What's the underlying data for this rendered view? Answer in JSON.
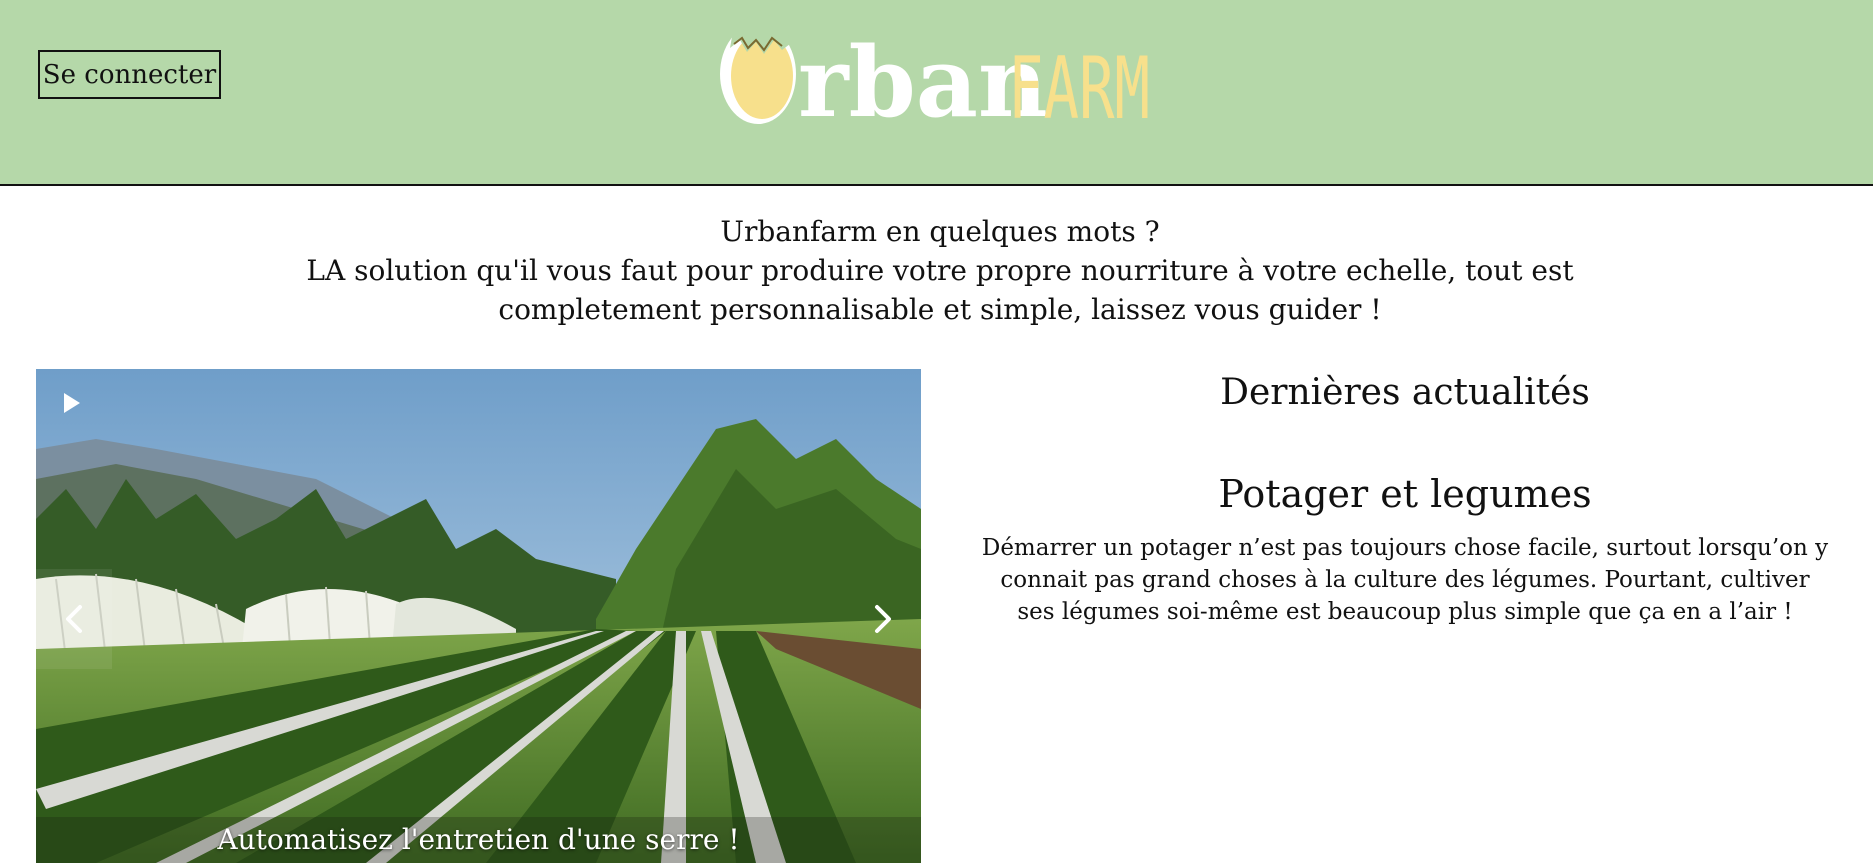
{
  "header": {
    "background_color": "#b5d8a9",
    "login_label": "Se connecter",
    "logo": {
      "text_primary": "rban",
      "text_accent": "FARM",
      "primary_color": "#ffffff",
      "accent_color": "#f7e08c"
    }
  },
  "intro": {
    "title": "Urbanfarm en quelques mots ?",
    "body": "LA solution qu'il vous faut pour produire votre propre nourriture à votre echelle, tout est completement personnalisable et simple, laissez vous guider !"
  },
  "carousel": {
    "play_icon": "play-icon",
    "prev_icon": "chevron-left-icon",
    "next_icon": "chevron-right-icon",
    "caption": "Automatisez l'entretien d'une serre !"
  },
  "news": {
    "heading": "Dernières actualités",
    "article_title": "Potager et legumes",
    "article_text": "Démarrer un potager n’est pas toujours chose facile, surtout lorsqu’on y connait pas grand choses à la culture des légumes. Pourtant, cultiver ses légumes soi-même est beaucoup plus simple que ça en a l’air !"
  }
}
